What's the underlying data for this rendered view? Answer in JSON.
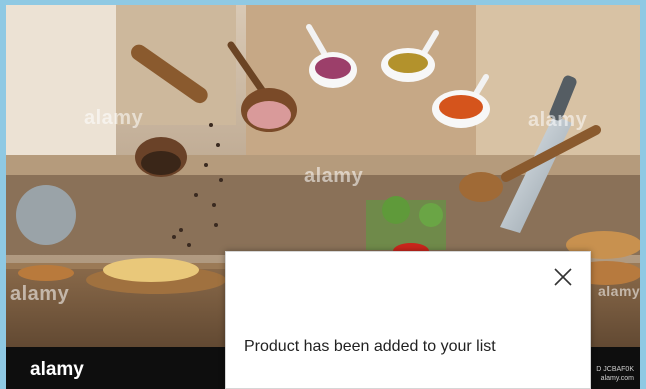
{
  "image": {
    "watermarks": [
      "alamy",
      "alamy",
      "alamy",
      "alamy",
      "alamy"
    ],
    "logo": "alamy",
    "credit_line1": "D JCBAF0K",
    "credit_line2": "alamy.com"
  },
  "notification": {
    "message": "Product has been added to your list",
    "close_icon": "close-icon"
  },
  "colors": {
    "page_border": "#8fc9e3",
    "notification_bg": "#ffffff",
    "text": "#222222"
  }
}
